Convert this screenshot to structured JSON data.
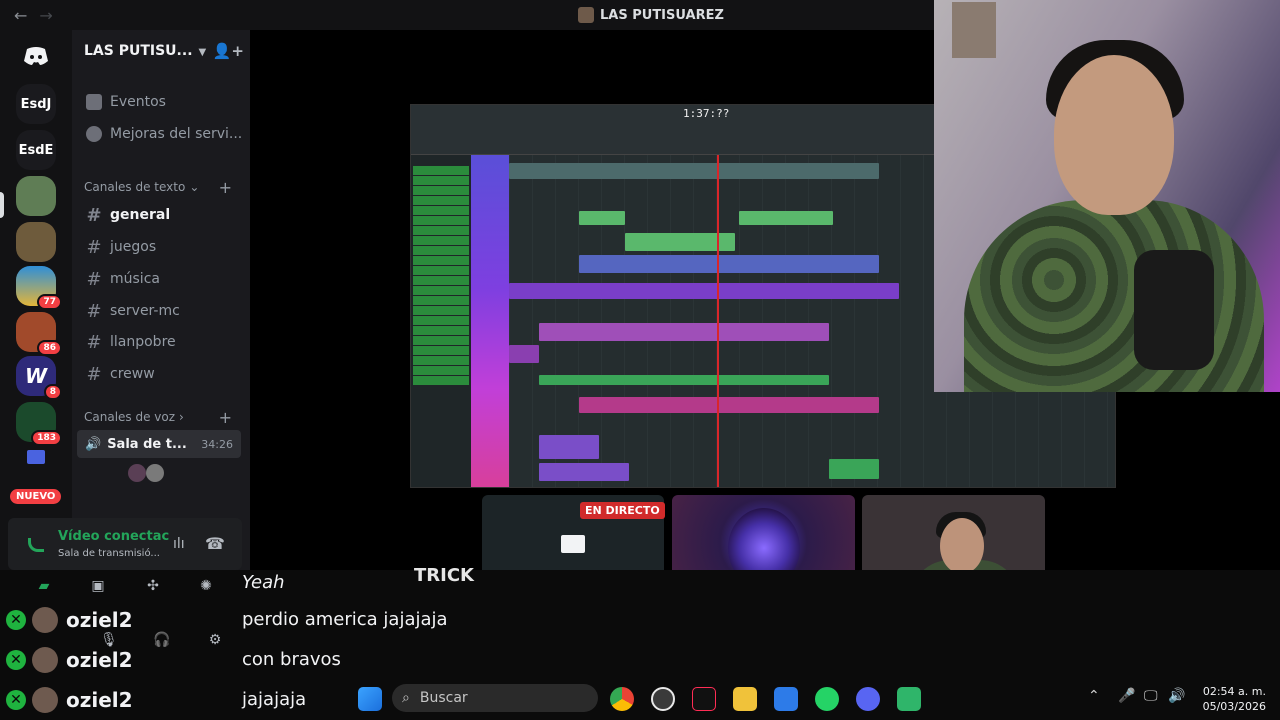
{
  "window": {
    "title": "LAS PUTISUAREZ"
  },
  "rail": {
    "items": [
      {
        "label": "",
        "icon": "discord-logo-icon"
      },
      {
        "label": "EsdJ"
      },
      {
        "label": "EsdE"
      },
      {
        "label": ""
      },
      {
        "label": ""
      },
      {
        "label": "",
        "badge": "77"
      },
      {
        "label": "",
        "badge": "86"
      },
      {
        "label": "",
        "badge": "8"
      },
      {
        "label": "",
        "badge": "183"
      }
    ],
    "nuevo": "NUEVO"
  },
  "sidebar": {
    "guild_name": "LAS PUTISU...",
    "items": [
      {
        "label": "Eventos"
      },
      {
        "label": "Mejoras del servi..."
      }
    ],
    "text_category": "Canales de texto",
    "channels": [
      "general",
      "juegos",
      "música",
      "server-mc",
      "llanpobre",
      "creww"
    ],
    "voice_category": "Canales de voz",
    "voice_channel": {
      "label": "Sala de t...",
      "time": "34:26"
    }
  },
  "voice_panel": {
    "title": "Vídeo conectac",
    "subtitle": "Sala de transmisió..."
  },
  "stream": {
    "daw_time": "1:37:??",
    "live_badge": "EN DIRECTO"
  },
  "chat": {
    "lines": [
      {
        "user": "",
        "message": "Yeah"
      },
      {
        "user": "oziel2",
        "message": "perdio america jajajaja"
      },
      {
        "user": "oziel2",
        "message": "con bravos"
      },
      {
        "user": "oziel2",
        "message": "jajajaja"
      }
    ],
    "overlay_word": "TRICK"
  },
  "taskbar": {
    "search_placeholder": "Buscar",
    "time": "02:54 a. m.",
    "date": "05/03/2026"
  },
  "colors": {
    "accent_green": "#23a55a",
    "live_red": "#d12b2b",
    "badge_red": "#f23f43"
  }
}
